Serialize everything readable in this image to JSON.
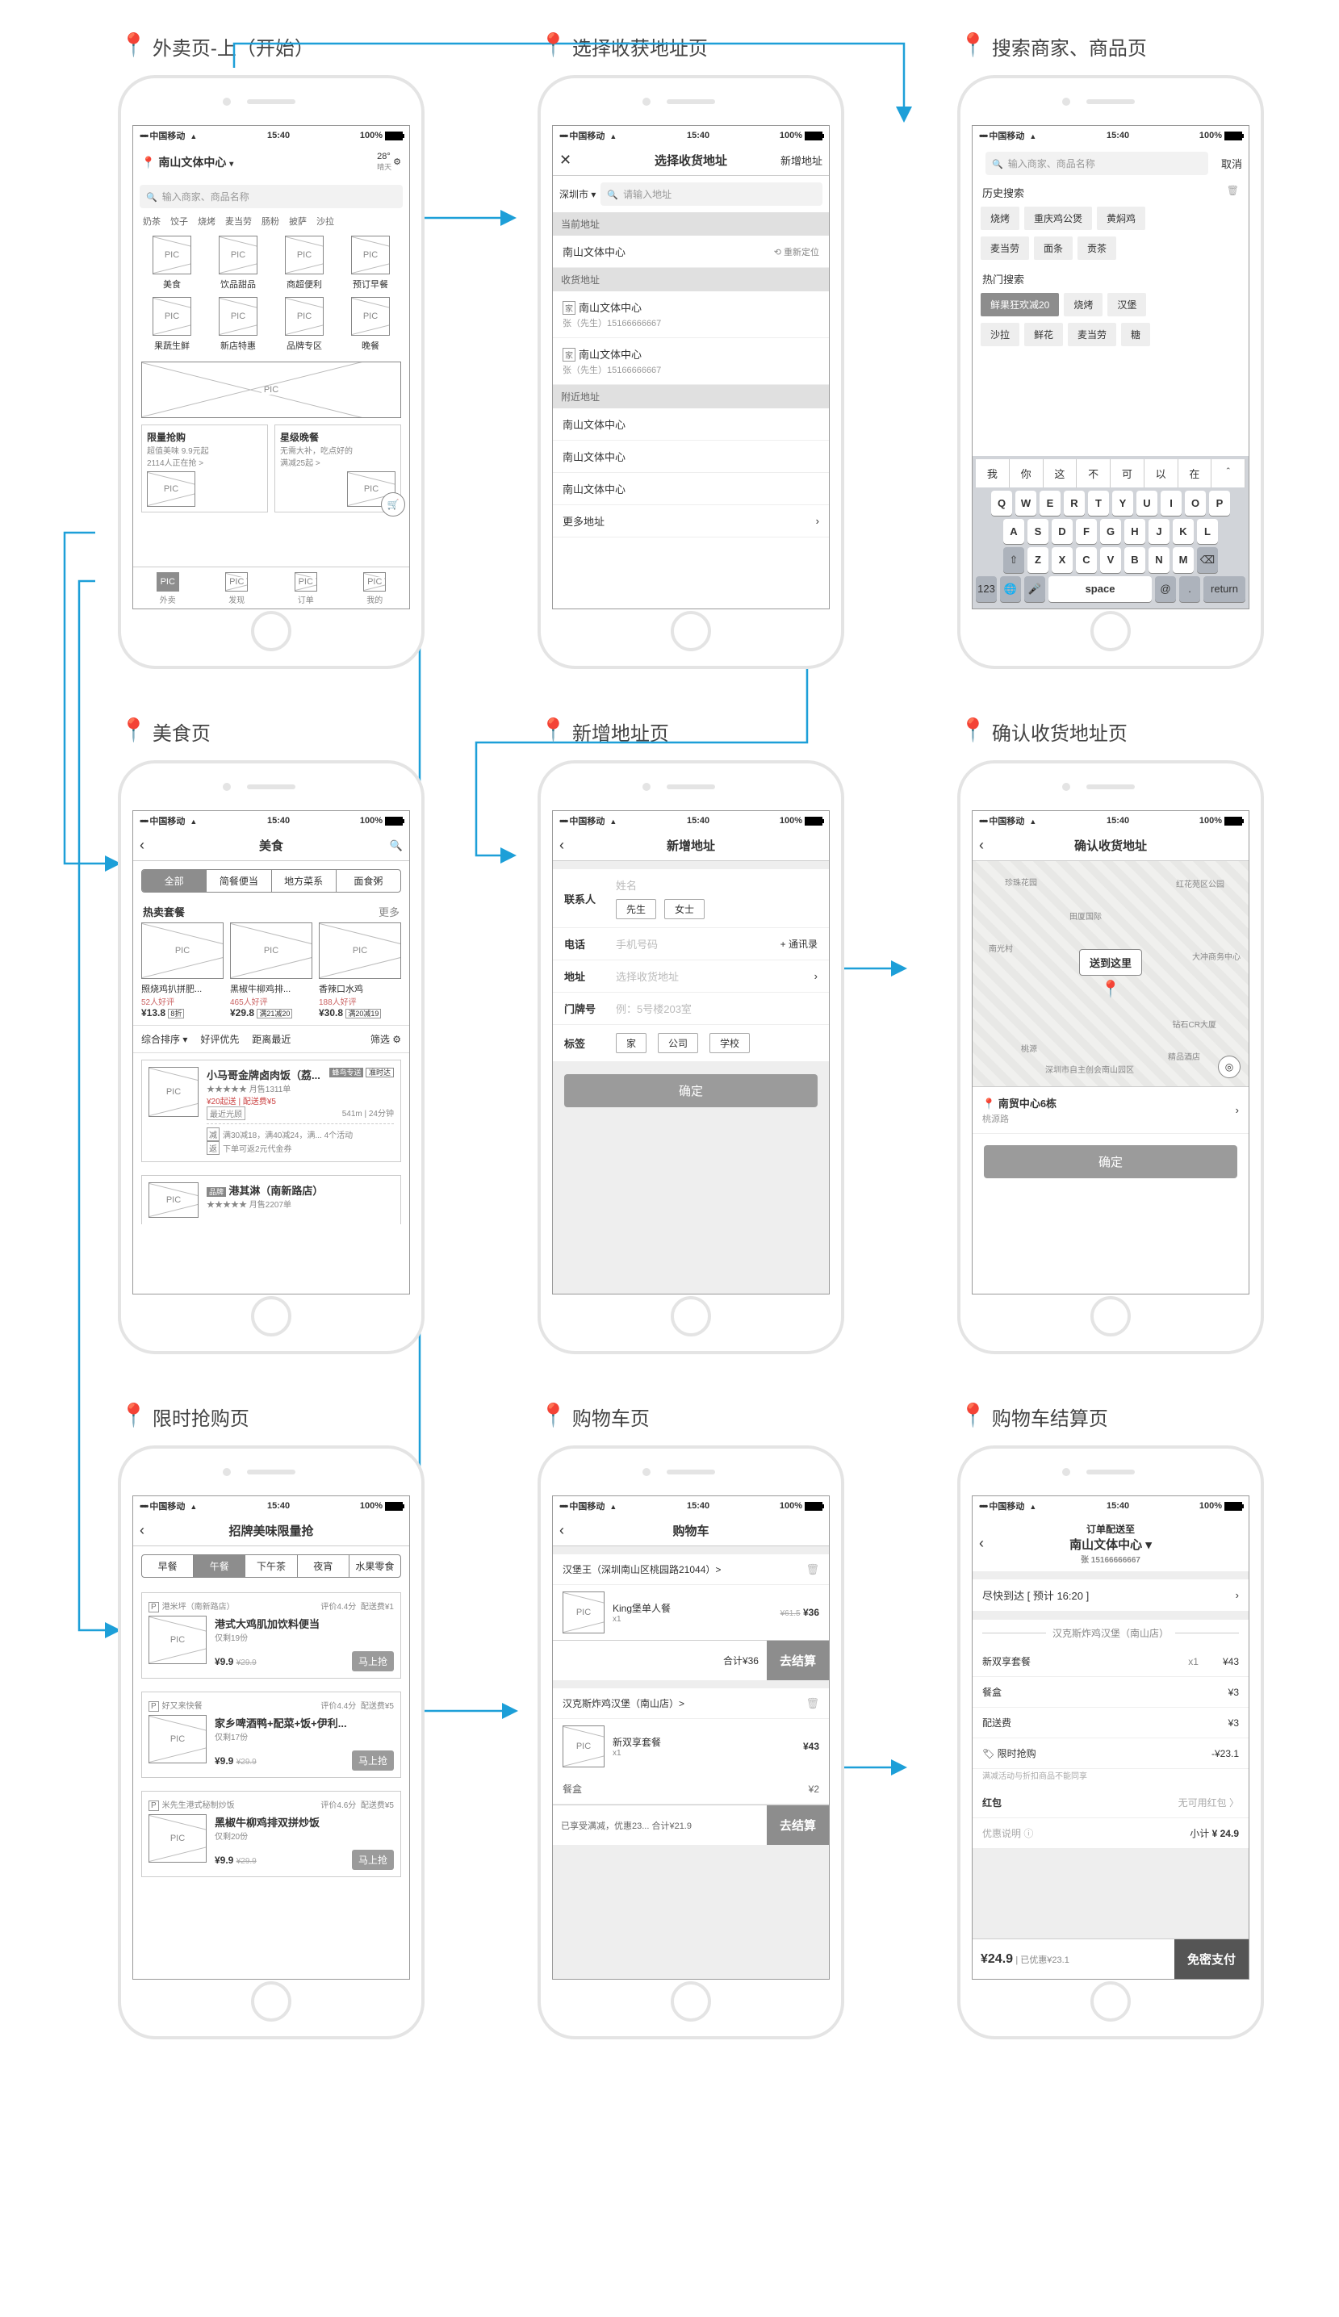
{
  "status": {
    "carrier": "中国移动",
    "time": "15:40",
    "battery_pct": "100%"
  },
  "screens": {
    "home": {
      "title": "外卖页-上（开始）"
    },
    "address": {
      "title": "选择收获地址页"
    },
    "search": {
      "title": "搜索商家、商品页"
    },
    "food": {
      "title": "美食页"
    },
    "addaddr": {
      "title": "新增地址页"
    },
    "confirm": {
      "title": "确认收货地址页"
    },
    "flash": {
      "title": "限时抢购页"
    },
    "cart": {
      "title": "购物车页"
    },
    "checkout": {
      "title": "购物车结算页"
    }
  },
  "home": {
    "location": "南山文体中心",
    "temp": "28°",
    "temp_sub": "晴天",
    "search_ph": "输入商家、商品名称",
    "tabs": [
      "奶茶",
      "饺子",
      "烧烤",
      "麦当劳",
      "肠粉",
      "披萨",
      "沙拉"
    ],
    "cats": [
      "美食",
      "饮品甜品",
      "商超便利",
      "预订早餐",
      "果蔬生鲜",
      "新店特惠",
      "品牌专区",
      "晚餐"
    ],
    "flash": {
      "t": "限量抢购",
      "s1": "超值美味 9.9元起",
      "s2": "2114人正在抢 >"
    },
    "star": {
      "t": "星级晚餐",
      "s1": "无需大补，吃点好的",
      "s2": "满减25起 >"
    },
    "nav": [
      "外卖",
      "发现",
      "订单",
      "我的"
    ]
  },
  "address": {
    "title": "选择收货地址",
    "add": "新增地址",
    "city": "深圳市",
    "search_ph": "请输入地址",
    "sec_current": "当前地址",
    "current": "南山文体中心",
    "relocate": "重新定位",
    "sec_saved": "收货地址",
    "saved": [
      {
        "tag": "家",
        "name": "南山文体中心",
        "sub": "张（先生）15166666667"
      },
      {
        "tag": "家",
        "name": "南山文体中心",
        "sub": "张（先生）15166666667"
      }
    ],
    "sec_near": "附近地址",
    "near": [
      "南山文体中心",
      "南山文体中心",
      "南山文体中心"
    ],
    "more": "更多地址"
  },
  "search": {
    "ph": "输入商家、商品名称",
    "cancel": "取消",
    "history_t": "历史搜索",
    "history": [
      "烧烤",
      "重庆鸡公煲",
      "黄焖鸡",
      "麦当劳",
      "面条",
      "贡茶"
    ],
    "hot_t": "热门搜索",
    "hot": [
      "鲜果狂欢减20",
      "烧烤",
      "汉堡",
      "沙拉",
      "鲜花",
      "麦当劳",
      "糖"
    ],
    "sug": [
      "我",
      "你",
      "这",
      "不",
      "可",
      "以",
      "在"
    ],
    "kb1": [
      "Q",
      "W",
      "E",
      "R",
      "T",
      "Y",
      "U",
      "I",
      "O",
      "P"
    ],
    "kb2": [
      "A",
      "S",
      "D",
      "F",
      "G",
      "H",
      "J",
      "K",
      "L"
    ],
    "kb3": [
      "Z",
      "X",
      "C",
      "V",
      "B",
      "N",
      "M"
    ],
    "kb4": {
      "n": "123",
      "globe": "🌐",
      "mic": "🎤",
      "space": "space",
      "at": "@",
      "dot": ".",
      "ret": "return"
    }
  },
  "food": {
    "title": "美食",
    "seg": [
      "全部",
      "简餐便当",
      "地方菜系",
      "面食粥"
    ],
    "hot_t": "热卖套餐",
    "more": "更多",
    "items": [
      {
        "n": "照烧鸡扒拼肥...",
        "r": "52人好评",
        "p": "¥13.8",
        "tag": "8折"
      },
      {
        "n": "黑椒牛柳鸡排...",
        "r": "465人好评",
        "p": "¥29.8",
        "tag": "满21减20"
      },
      {
        "n": "香辣口水鸡",
        "r": "188人好评",
        "p": "¥30.8",
        "tag": "满20减19"
      }
    ],
    "filter": {
      "sort": "综合排序",
      "a": "好评优先",
      "b": "距离最近",
      "c": "筛选"
    },
    "shop1": {
      "n": "小马哥金牌卤肉饭（荔...",
      "stars": "★★★★★",
      "sales": "月售1311单",
      "b1": "蜂鸟专送",
      "b2": "准时达",
      "l1": "¥20起送 | 配送费¥5",
      "l2": "541m | 24分钟",
      "near": "最近光顾",
      "r1": "满30减18，满40减24，满...   4个活动",
      "r2": "下单可返2元代金券"
    },
    "shop2": {
      "tag": "品牌",
      "n": "港其淋（南新路店）",
      "stars": "★★★★★",
      "sales": "月售2207单"
    }
  },
  "addaddr": {
    "title": "新增地址",
    "rows": {
      "contact": {
        "l": "联系人",
        "ph": "姓名",
        "b1": "先生",
        "b2": "女士"
      },
      "phone": {
        "l": "电话",
        "ph": "手机号码",
        "r": "+ 通讯录"
      },
      "addr": {
        "l": "地址",
        "ph": "选择收货地址"
      },
      "room": {
        "l": "门牌号",
        "ph": "例：5号楼203室"
      },
      "tag": {
        "l": "标签",
        "b1": "家",
        "b2": "公司",
        "b3": "学校"
      }
    },
    "ok": "确定"
  },
  "confirm": {
    "title": "确认收货地址",
    "bubble": "送到这里",
    "labels": {
      "p1": "珍珠花园",
      "p2": "田厦国际",
      "p3": "红花苑区公园",
      "p4": "大冲商务中心",
      "p5": "南光村",
      "p6": "钻石CR大厦",
      "p7": "桃源",
      "p8": "深圳市自主创会南山园区",
      "p9": "精品酒店"
    },
    "addr": "南贸中心6栋",
    "road": "桃源路",
    "ok": "确定"
  },
  "flash": {
    "title": "招牌美味限量抢",
    "seg": [
      "早餐",
      "午餐",
      "下午茶",
      "夜宵",
      "水果零食"
    ],
    "items": [
      {
        "shop": "港米坪（南新路店）",
        "rate": "评价4.4分",
        "ship": "配送费¥1",
        "n": "港式大鸡肌加饮料便当",
        "left": "仅剩19份",
        "p": "¥9.9",
        "op": "¥29.9",
        "btn": "马上抢"
      },
      {
        "shop": "好又来快餐",
        "rate": "评价4.4分",
        "ship": "配送费¥5",
        "n": "家乡啤酒鸭+配菜+饭+伊利...",
        "left": "仅剩17份",
        "p": "¥9.9",
        "op": "¥29.9",
        "btn": "马上抢"
      },
      {
        "shop": "米先生港式秘制炒饭",
        "rate": "评价4.6分",
        "ship": "配送费¥5",
        "n": "黑椒牛柳鸡排双拼炒饭",
        "left": "仅剩20份",
        "p": "¥9.9",
        "op": "¥29.9",
        "btn": "马上抢"
      }
    ]
  },
  "cart": {
    "title": "购物车",
    "g1": {
      "shop": "汉堡王（深圳南山区桃园路21044）>",
      "item": "King堡单人餐",
      "qty": "x1",
      "op": "¥61.5",
      "p": "¥36",
      "sum": "合计¥36",
      "go": "去结算"
    },
    "g2": {
      "shop": "汉克斯炸鸡汉堡（南山店）>",
      "item": "新双享套餐",
      "qty": "x1",
      "p": "¥43",
      "extra_l": "餐盒",
      "extra_p": "¥2",
      "bar": "已享受满减，优惠23...  合计¥21.9",
      "go": "去结算"
    }
  },
  "checkout": {
    "t1": "订单配送至",
    "addr": "南山文体中心",
    "who": "张 15166666667",
    "eta": "尽快到达 [ 预计 16:20 ]",
    "shop": "汉克斯炸鸡汉堡（南山店）",
    "rows": [
      {
        "n": "新双享套餐",
        "q": "x1",
        "p": "¥43"
      },
      {
        "n": "餐盒",
        "q": "",
        "p": "¥3"
      },
      {
        "n": "配送费",
        "q": "",
        "p": "¥3"
      },
      {
        "n": "限时抢购",
        "q": "",
        "p": "-¥23.1",
        "icon": "🏷"
      }
    ],
    "note": "满减活动与折扣商品不能同享",
    "red_l": "红包",
    "red_r": "无可用红包  〉",
    "coupon": "优惠说明 ⓘ",
    "sub_l": "小计",
    "sub_p": "¥ 24.9",
    "total": "¥24.9",
    "save": "| 已优惠¥23.1",
    "pay": "免密支付"
  }
}
